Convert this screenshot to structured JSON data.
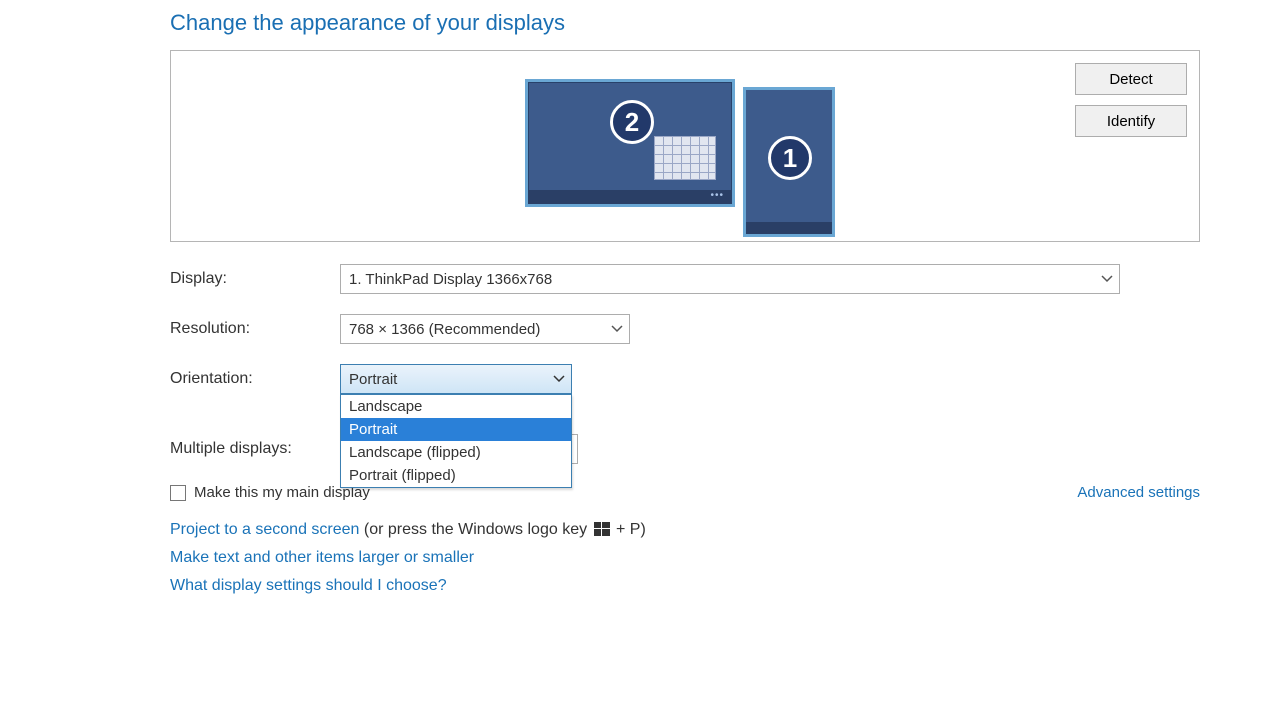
{
  "title": "Change the appearance of your displays",
  "buttons": {
    "detect": "Detect",
    "identify": "Identify"
  },
  "monitors": {
    "num1": "1",
    "num2": "2"
  },
  "labels": {
    "display": "Display:",
    "resolution": "Resolution:",
    "orientation": "Orientation:",
    "multiple": "Multiple displays:"
  },
  "display_value": "1. ThinkPad Display 1366x768",
  "resolution_value": "768 × 1366 (Recommended)",
  "orientation_value": "Portrait",
  "orientation_options": [
    "Landscape",
    "Portrait",
    "Landscape (flipped)",
    "Portrait (flipped)"
  ],
  "orientation_selected_index": 1,
  "multiple_value": "",
  "checkbox_label": "Make this my main display",
  "advanced": "Advanced settings",
  "bottom": {
    "project_link": "Project to a second screen",
    "project_rest_a": " (or press the Windows logo key ",
    "project_rest_b": " + P)",
    "textsize": "Make text and other items larger or smaller",
    "help": "What display settings should I choose?"
  }
}
